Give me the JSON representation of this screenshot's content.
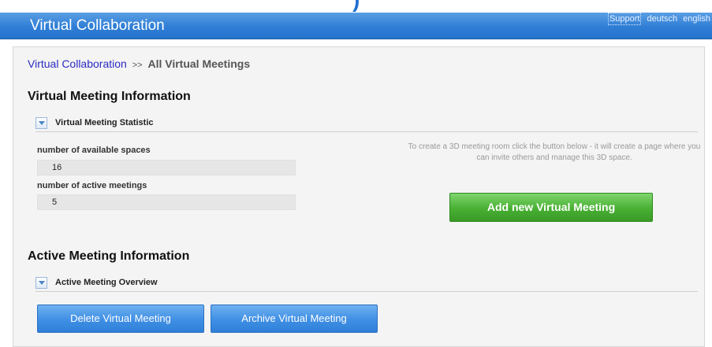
{
  "header": {
    "title": "Virtual Collaboration",
    "links": {
      "support": "Support",
      "german": "deutsch",
      "english": "english"
    }
  },
  "breadcrumb": {
    "parent": "Virtual Collaboration",
    "separator": ">>",
    "current": "All Virtual Meetings"
  },
  "meeting_info": {
    "title": "Virtual Meeting Information",
    "statistic_label": "Virtual Meeting Statistic",
    "available_spaces_label": "number of available spaces",
    "available_spaces_value": "16",
    "active_meetings_label": "number of active meetings",
    "active_meetings_value": "5",
    "hint": "To create a 3D meeting room click the button below - it will create a page where you can invite others and manage this 3D space.",
    "add_button": "Add new Virtual Meeting"
  },
  "active_info": {
    "title": "Active Meeting Information",
    "overview_label": "Active Meeting Overview",
    "delete_button": "Delete Virtual Meeting",
    "archive_button": "Archive Virtual Meeting"
  },
  "colors": {
    "header_blue": "#2f7ed6",
    "add_green": "#48b033",
    "button_blue": "#3f8fe4",
    "link": "#2b2bc2"
  }
}
